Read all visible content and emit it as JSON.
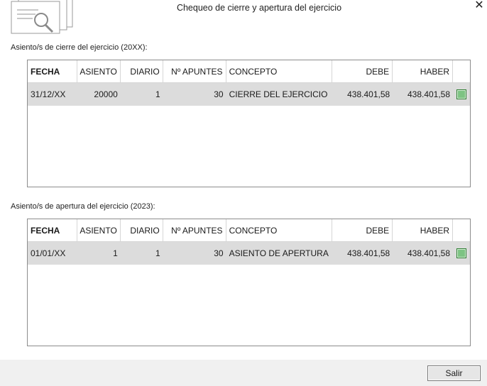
{
  "dialog": {
    "title": "Chequeo de cierre y apertura del ejercicio",
    "close_icon": "close-icon",
    "header_icon": "document-search-icon"
  },
  "cierre": {
    "label": "Asiento/s de cierre del ejercicio (20XX):",
    "columns": [
      "FECHA",
      "ASIENTO",
      "DIARIO",
      "Nº APUNTES",
      "CONCEPTO",
      "DEBE",
      "HABER"
    ],
    "rows": [
      {
        "fecha": "31/12/XX",
        "asiento": "20000",
        "diario": "1",
        "apuntes": "30",
        "concepto": "CIERRE DEL EJERCICIO",
        "debe": "438.401,58",
        "haber": "438.401,58",
        "checked": true
      }
    ]
  },
  "apertura": {
    "label": "Asiento/s de apertura del ejercicio (2023):",
    "columns": [
      "FECHA",
      "ASIENTO",
      "DIARIO",
      "Nº APUNTES",
      "CONCEPTO",
      "DEBE",
      "HABER"
    ],
    "rows": [
      {
        "fecha": "01/01/XX",
        "asiento": "1",
        "diario": "1",
        "apuntes": "30",
        "concepto": "ASIENTO DE APERTURA",
        "debe": "438.401,58",
        "haber": "438.401,58",
        "checked": true
      }
    ]
  },
  "footer": {
    "salir_label": "Salir"
  },
  "colors": {
    "row_background": "#dcdcdc",
    "check_green": "#7dc383",
    "footer_background": "#f0f0f0"
  }
}
